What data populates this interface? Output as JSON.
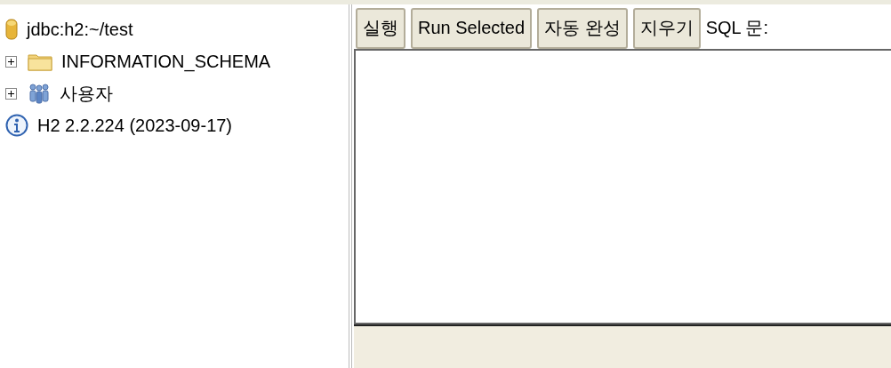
{
  "tree": {
    "items": [
      {
        "kind": "database",
        "label": "jdbc:h2:~/test"
      },
      {
        "kind": "folder",
        "label": "INFORMATION_SCHEMA",
        "expanded": false
      },
      {
        "kind": "users",
        "label": "사용자",
        "expanded": false
      },
      {
        "kind": "info",
        "label": "H2 2.2.224 (2023-09-17)"
      }
    ]
  },
  "toolbar": {
    "buttons": [
      "실행",
      "Run Selected",
      "자동 완성",
      "지우기"
    ],
    "label": "SQL 문:"
  }
}
